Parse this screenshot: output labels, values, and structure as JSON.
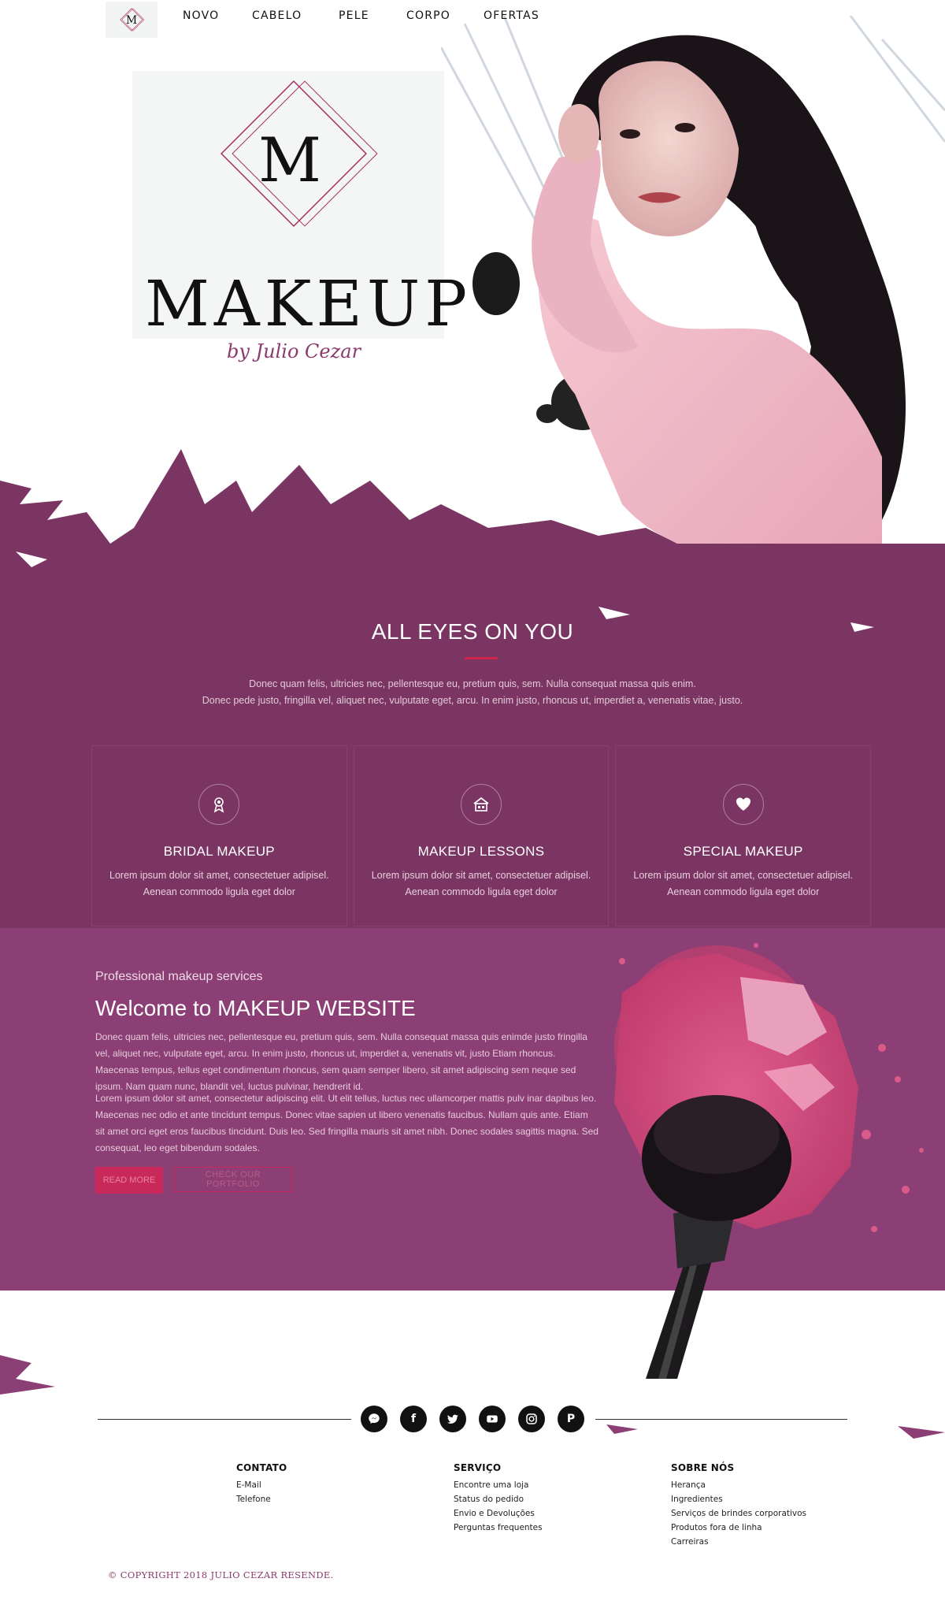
{
  "nav": {
    "items": [
      "NOVO",
      "CABELO",
      "PELE",
      "CORPO",
      "OFERTAS"
    ]
  },
  "hero": {
    "logo_word": "MAKEUP",
    "logo_signature": "by Julio Cezar"
  },
  "intro": {
    "title": "ALL EYES ON YOU",
    "line1": "Donec quam felis, ultricies nec, pellentesque eu, pretium quis, sem. Nulla consequat massa quis enim.",
    "line2": "Donec pede justo, fringilla vel, aliquet nec, vulputate eget, arcu. In enim justo, rhoncus ut, imperdiet a, venenatis vitae, justo."
  },
  "services": [
    {
      "title": "BRIDAL MAKEUP",
      "line1": "Lorem ipsum dolor sit amet, consectetuer adipisel.",
      "line2": "Aenean commodo ligula eget dolor",
      "icon": "award-ribbon-icon"
    },
    {
      "title": "MAKEUP LESSONS",
      "line1": "Lorem ipsum dolor sit amet, consectetuer adipisel.",
      "line2": "Aenean commodo ligula eget dolor",
      "icon": "school-house-icon"
    },
    {
      "title": "SPECIAL MAKEUP",
      "line1": "Lorem ipsum dolor sit amet, consectetuer adipisel.",
      "line2": "Aenean commodo ligula eget dolor",
      "icon": "heart-icon"
    }
  ],
  "welcome": {
    "kicker": "Professional makeup services",
    "title": "Welcome to MAKEUP WEBSITE",
    "p1": "Donec quam felis, ultricies nec, pellentesque eu, pretium quis, sem. Nulla consequat massa quis enimde justo fringilla vel, aliquet nec, vulputate eget, arcu. In enim justo, rhoncus ut, imperdiet a, venenatis vit, justo Etiam rhoncus. Maecenas tempus, tellus eget condimentum rhoncus, sem quam semper libero, sit amet adipiscing sem neque sed ipsum. Nam quam nunc, blandit vel, luctus pulvinar, hendrerit id.",
    "p2": "Lorem ipsum dolor sit amet, consectetur adipiscing elit. Ut elit tellus, luctus nec ullamcorper mattis pulv inar dapibus leo. Maecenas nec odio et ante tincidunt tempus. Donec vitae sapien ut libero venenatis faucibus. Nullam quis ante. Etiam sit amet orci eget eros faucibus tincidunt. Duis leo. Sed fringilla mauris sit amet nibh. Donec sodales sagittis magna. Sed consequat, leo eget bibendum sodales.",
    "btn_read": "READ MORE",
    "btn_other": "CHECK OUR PORTFOLIO"
  },
  "social": [
    "messenger-icon",
    "facebook-icon",
    "twitter-icon",
    "youtube-icon",
    "instagram-icon",
    "pinterest-icon"
  ],
  "footer": {
    "contato": {
      "title": "CONTATO",
      "items": [
        "E-Mail",
        "Telefone"
      ]
    },
    "servico": {
      "title": "SERVIÇO",
      "items": [
        "Encontre uma loja",
        "Status do pedido",
        "Envio e Devoluções",
        "Perguntas frequentes"
      ]
    },
    "sobre": {
      "title": "SOBRE NÓS",
      "items": [
        "Herança",
        "Ingredientes",
        "Serviços de brindes corporativos",
        "Produtos fora de linha",
        "Carreiras"
      ]
    }
  },
  "copyright": "© COPYRIGHT 2018 JULIO CEZAR RESENDE.",
  "colors": {
    "plum": "#7b3563",
    "plum_light": "#8c3f75",
    "accent": "#c9285a"
  }
}
